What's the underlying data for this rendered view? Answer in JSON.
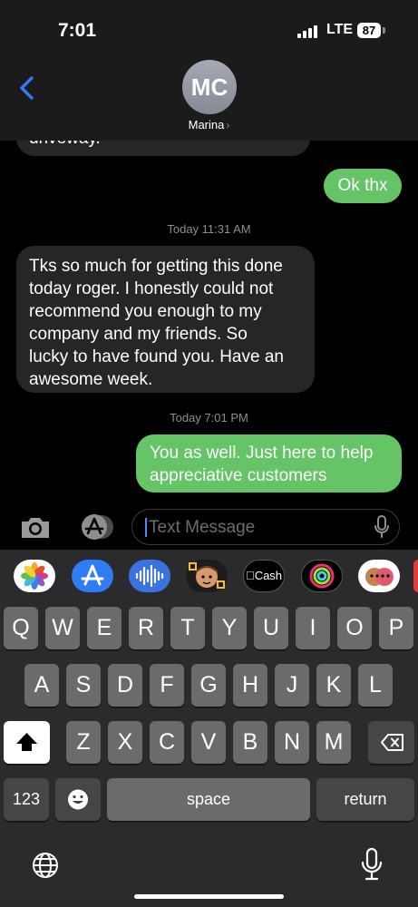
{
  "status_bar": {
    "time": "7:01",
    "network": "LTE",
    "battery": "87"
  },
  "header": {
    "avatar_initials": "MC",
    "contact_name": "Marina",
    "chevron": "›"
  },
  "messages": [
    {
      "type": "incoming-partial",
      "text": "driveway."
    },
    {
      "type": "outgoing",
      "text": "Ok thx"
    },
    {
      "type": "timestamp",
      "text": "Today 11:31 AM"
    },
    {
      "type": "incoming",
      "lines": [
        "Tks so much for getting this done",
        "today roger. I honestly could not",
        "recommend you enough to my",
        "company and my friends. So",
        "lucky to have found you. Have an",
        "awesome week."
      ]
    },
    {
      "type": "timestamp",
      "text": "Today 7:01 PM"
    },
    {
      "type": "outgoing",
      "lines": [
        "You as well. Just here to help",
        "appreciative customers"
      ]
    }
  ],
  "input_bar": {
    "placeholder": "Text Message"
  },
  "app_strip": {
    "cash_label": "Cash"
  },
  "keyboard": {
    "row1": [
      "Q",
      "W",
      "E",
      "R",
      "T",
      "Y",
      "U",
      "I",
      "O",
      "P"
    ],
    "row2": [
      "A",
      "S",
      "D",
      "F",
      "G",
      "H",
      "J",
      "K",
      "L"
    ],
    "row3": [
      "Z",
      "X",
      "C",
      "V",
      "B",
      "N",
      "M"
    ],
    "numbers_label": "123",
    "space_label": "space",
    "return_label": "return"
  },
  "icons": [
    "back-chevron-icon",
    "camera-icon",
    "app-store-icon",
    "microphone-icon",
    "photos-icon",
    "audio-icon",
    "memoji-icon",
    "cash-icon",
    "activity-icon",
    "shift-icon",
    "delete-icon",
    "emoji-icon",
    "globe-icon",
    "dictation-icon"
  ],
  "colors": {
    "outgoing": "#65c466",
    "incoming": "#262628",
    "accent": "#3478f6"
  }
}
